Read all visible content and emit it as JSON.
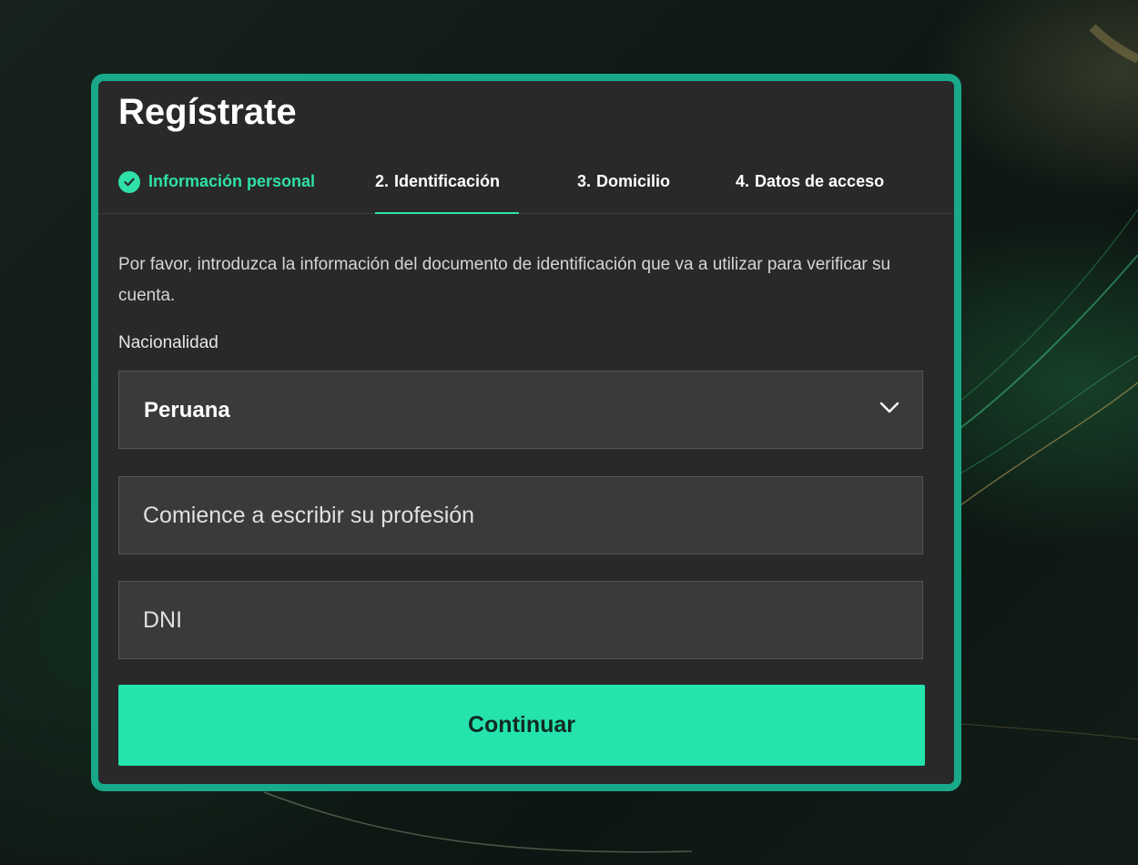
{
  "theme": {
    "accent": "#24e3ad",
    "card_border": "#1aa88a",
    "card_background": "#292929",
    "field_background": "#3a3a3a"
  },
  "form": {
    "title": "Regístrate",
    "steps": [
      {
        "number": "",
        "label": "Información personal",
        "state": "completed",
        "icon": "check-circle-icon"
      },
      {
        "number": "2.",
        "label": "Identificación",
        "state": "active"
      },
      {
        "number": "3.",
        "label": "Domicilio",
        "state": "pending"
      },
      {
        "number": "4.",
        "label": "Datos de acceso",
        "state": "pending"
      }
    ],
    "description": "Por favor, introduzca la información del documento de identificación que va a utilizar para verificar su cuenta.",
    "nationality": {
      "label": "Nacionalidad",
      "value": "Peruana",
      "icon": "chevron-down-icon"
    },
    "profession": {
      "placeholder": "Comience a escribir su profesión",
      "value": ""
    },
    "document": {
      "placeholder": "DNI",
      "value": ""
    },
    "continue_label": "Continuar"
  }
}
